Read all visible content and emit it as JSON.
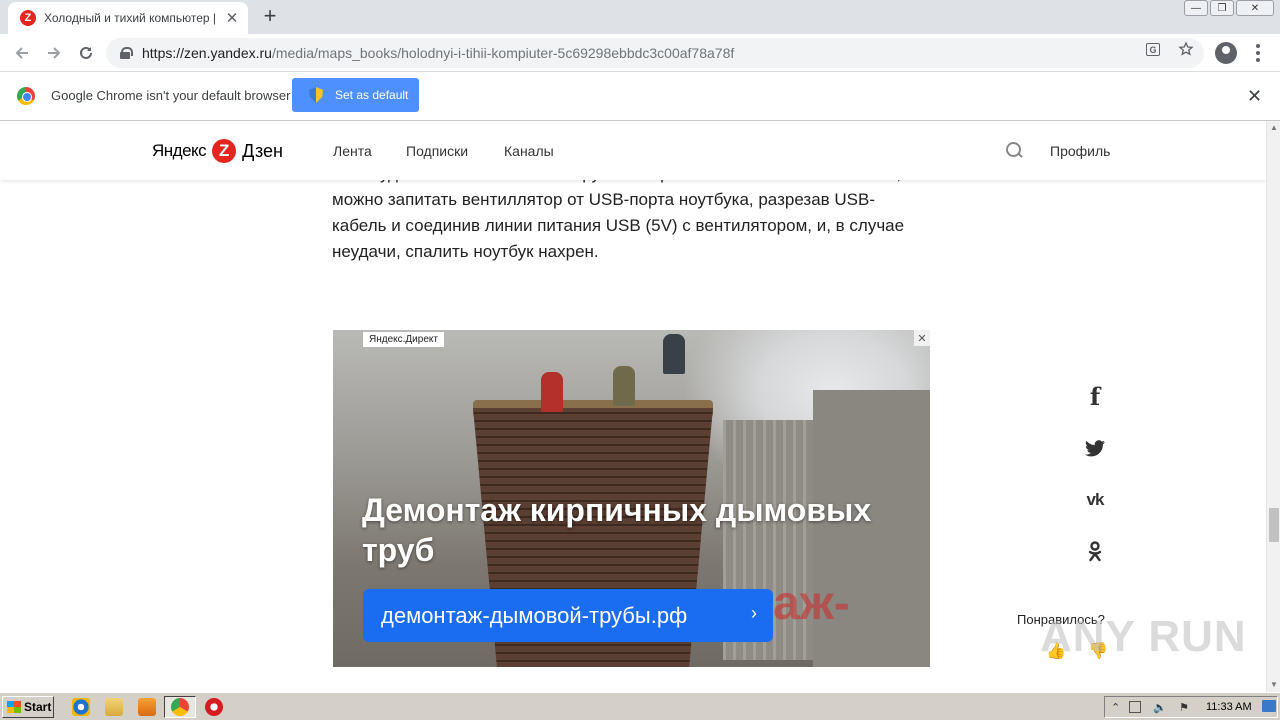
{
  "browser": {
    "tab_title": "Холодный и тихий компьютер | Ка",
    "tab_close": "✕",
    "new_tab": "+",
    "url_host": "https://zen.yandex.ru",
    "url_path": "/media/maps_books/holodnyi-i-tihii-kompiuter-5c69298ebbdc3c00af78a78f",
    "translate_icon_glyph": "G",
    "window_controls": [
      "—",
      "❐",
      "✕"
    ]
  },
  "infobar": {
    "message": "Google Chrome isn't your default browser",
    "button": "Set as default",
    "close": "✕"
  },
  "site": {
    "logo_left": "Яндекс",
    "logo_badge": "Z",
    "logo_right": "Дзен",
    "nav": [
      "Лента",
      "Подписки",
      "Каналы"
    ],
    "profile": "Профиль"
  },
  "article": {
    "lines": [
      "зато будет изготовлена своими руками. При известной бесшабашности,",
      "можно запитать вентиллятор от USB-порта ноутбука, разрезав USB-",
      "кабель и соединив линии питания USB (5V) с вентилятором, и, в случае",
      "неудачи, спалить ноутбук нахрен."
    ]
  },
  "ad": {
    "label": "Яндекс.Директ",
    "close": "✕",
    "headline": "Демонтаж кирпичных дымовых труб",
    "cta": "демонтаж-дымовой-трубы.рф",
    "cta_chevron": "›",
    "bg_text": "аж-"
  },
  "share": {
    "facebook": "f",
    "twitter": "🐦",
    "vk": "vk",
    "ok": "ок",
    "liked_prompt": "Понравилось?",
    "like": "👍",
    "dislike": "👎"
  },
  "watermark": "ANY RUN",
  "taskbar": {
    "start": "Start",
    "clock": "11:33 AM"
  },
  "colors": {
    "yandex_red": "#e52620",
    "cta_blue": "#1a6cf0",
    "infobar_button": "#4d90fe"
  }
}
